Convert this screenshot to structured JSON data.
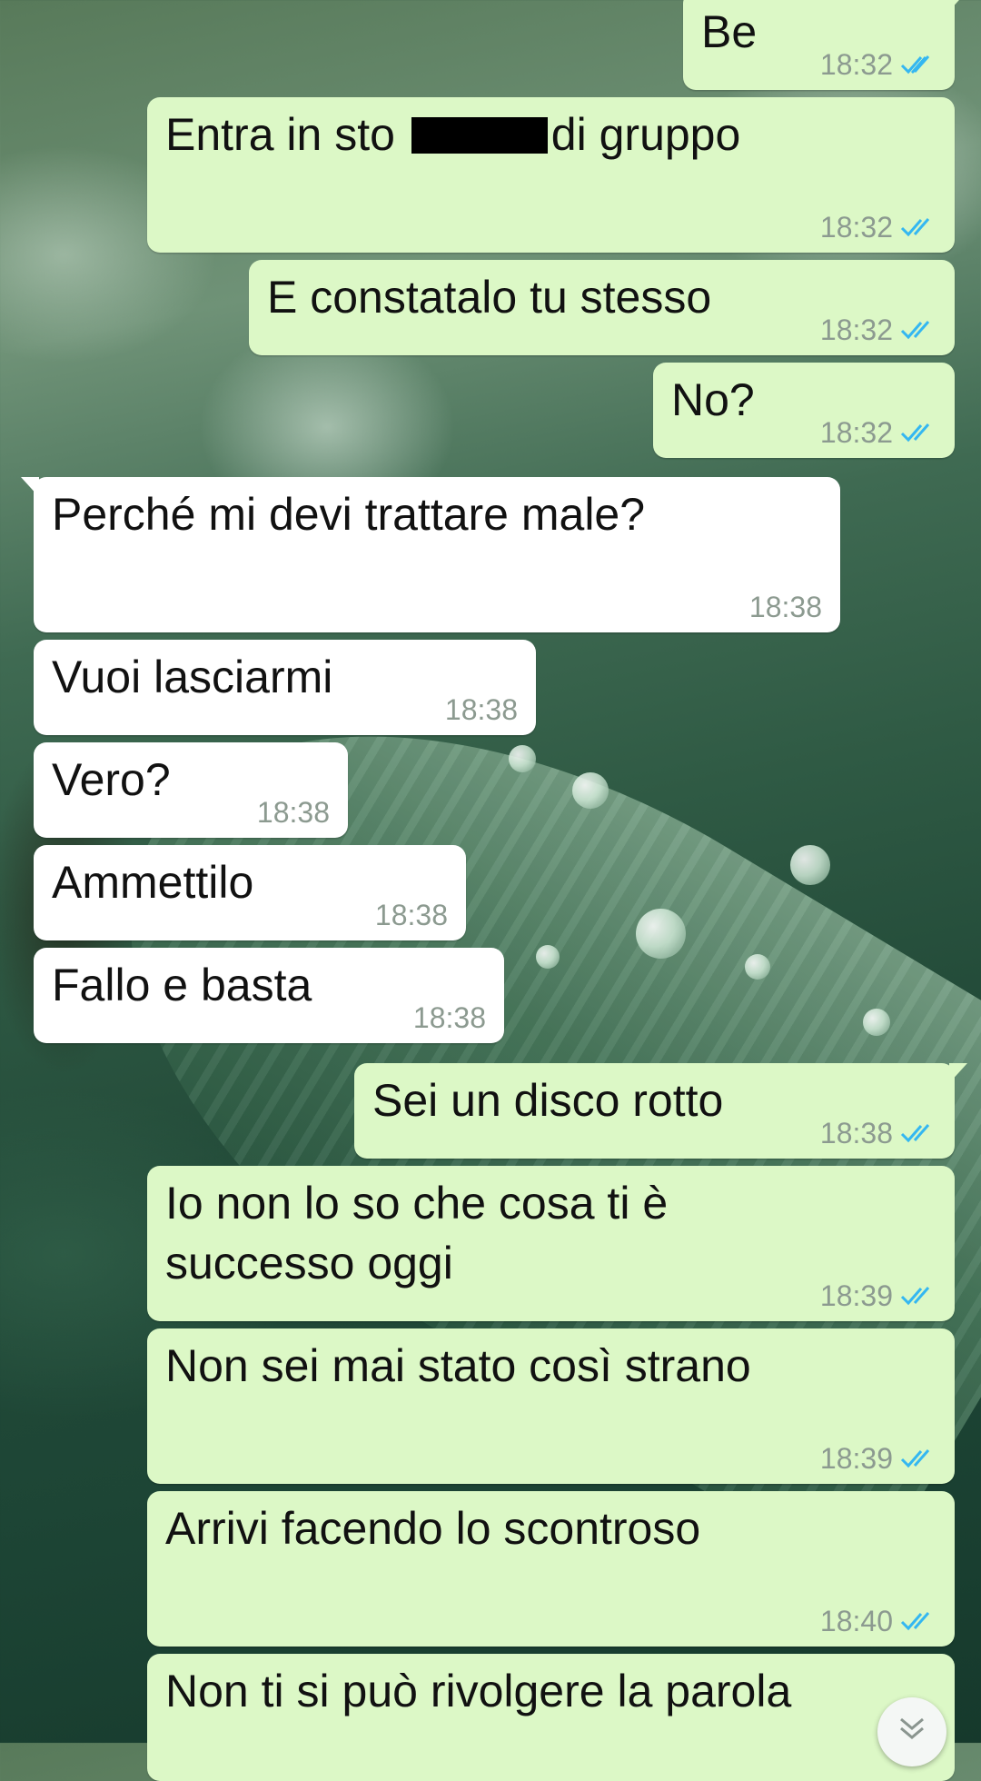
{
  "messages": [
    {
      "direction": "outgoing",
      "text": "Be",
      "time": "18:32",
      "status": "read-double-tick"
    },
    {
      "direction": "outgoing",
      "text_before": "Entra in sto ",
      "text_after": "di gruppo",
      "redacted": true,
      "time": "18:32",
      "status": "read-double-tick"
    },
    {
      "direction": "outgoing",
      "text": "E constatalo tu stesso",
      "time": "18:32",
      "status": "read-double-tick"
    },
    {
      "direction": "outgoing",
      "text": "No?",
      "time": "18:32",
      "status": "read-double-tick"
    },
    {
      "direction": "incoming",
      "text": "Perché mi devi trattare male?",
      "time": "18:38"
    },
    {
      "direction": "incoming",
      "text": "Vuoi lasciarmi",
      "time": "18:38"
    },
    {
      "direction": "incoming",
      "text": "Vero?",
      "time": "18:38"
    },
    {
      "direction": "incoming",
      "text": "Ammettilo",
      "time": "18:38"
    },
    {
      "direction": "incoming",
      "text": "Fallo e basta",
      "time": "18:38"
    },
    {
      "direction": "outgoing",
      "text": "Sei un disco rotto",
      "time": "18:38",
      "status": "read-double-tick"
    },
    {
      "direction": "outgoing",
      "text": "Io non lo so che cosa ti è\nsuccesso oggi",
      "time": "18:39",
      "status": "read-double-tick"
    },
    {
      "direction": "outgoing",
      "text": "Non sei mai stato così strano",
      "time": "18:39",
      "status": "read-double-tick"
    },
    {
      "direction": "outgoing",
      "text": "Arrivi facendo lo scontroso",
      "time": "18:40",
      "status": "read-double-tick"
    },
    {
      "direction": "outgoing",
      "text": "Non ti si può rivolgere la parola",
      "time": "",
      "status": ""
    }
  ],
  "colors": {
    "outgoing_bubble": "#dcf8c6",
    "incoming_bubble": "#ffffff",
    "read_tick": "#34b7f1",
    "timestamp": "#8c9a90"
  },
  "icons": {
    "read_status": "double-check-icon",
    "scroll_down": "double-chevron-down-icon"
  }
}
